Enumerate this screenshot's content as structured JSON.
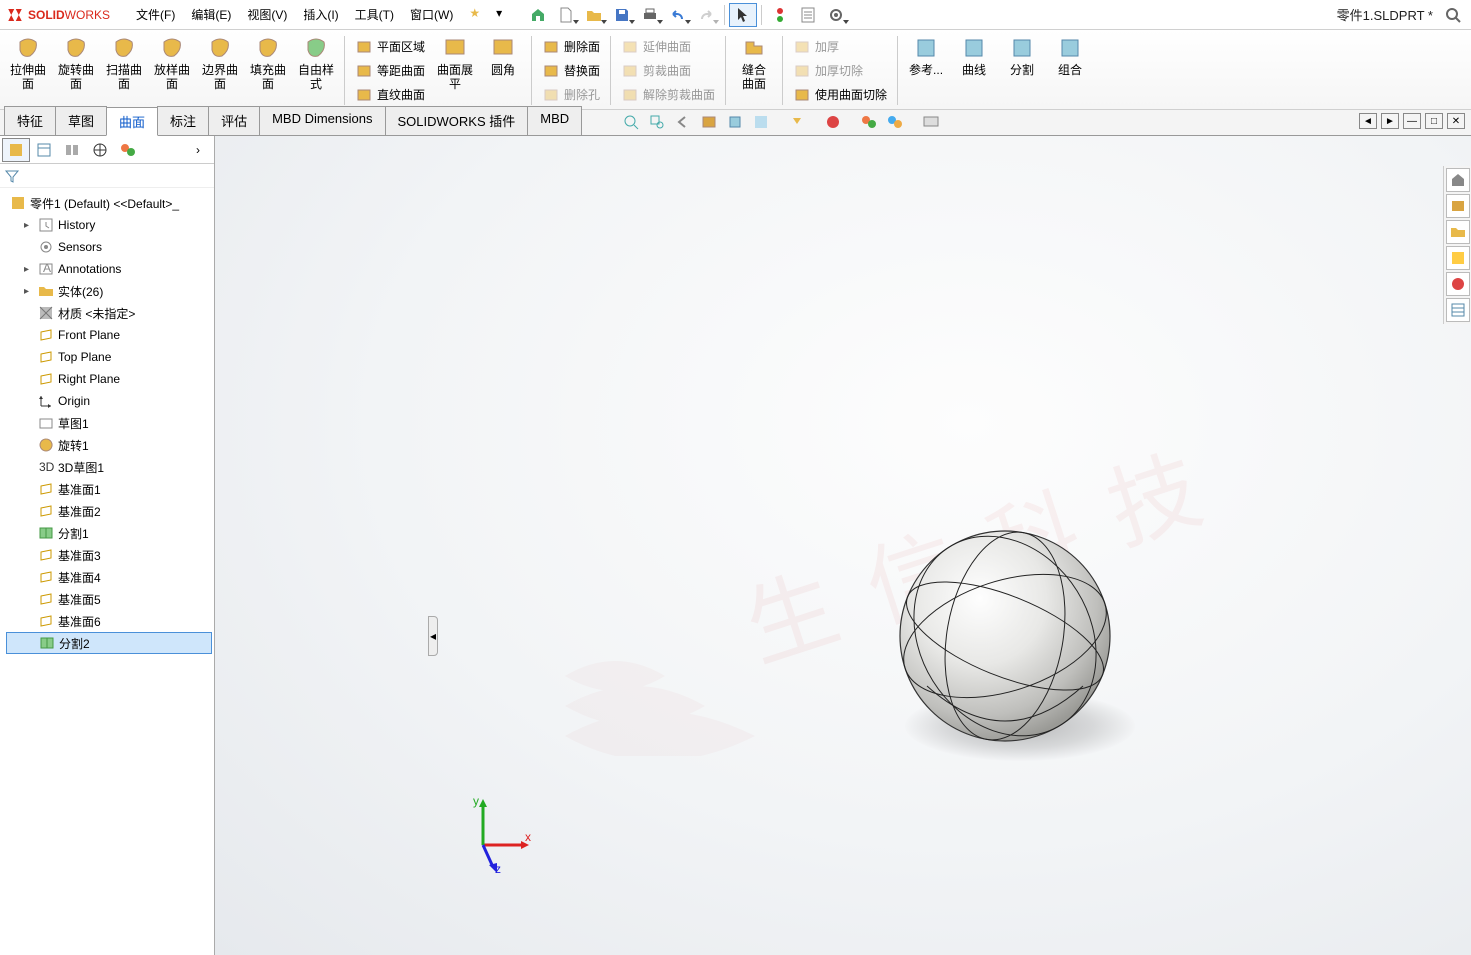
{
  "app": {
    "name_prefix": "SOLID",
    "name_suffix": "WORKS"
  },
  "document_title": "零件1.SLDPRT *",
  "menu": [
    "文件(F)",
    "编辑(E)",
    "视图(V)",
    "插入(I)",
    "工具(T)",
    "窗口(W)"
  ],
  "ribbon_large": [
    "拉伸曲\n面",
    "旋转曲\n面",
    "扫描曲\n面",
    "放样曲\n面",
    "边界曲\n面",
    "填充曲\n面",
    "自由样\n式"
  ],
  "ribbon_mid_a": [
    "平面区域",
    "等距曲面",
    "直纹曲面"
  ],
  "ribbon_mid_b": [
    "曲面展\n平",
    "圆角"
  ],
  "ribbon_mid_c": [
    "删除面",
    "替换面",
    "删除孔"
  ],
  "ribbon_mid_d": [
    "延伸曲面",
    "剪裁曲面",
    "解除剪裁曲面"
  ],
  "ribbon_mid_e": [
    "缝合\n曲面"
  ],
  "ribbon_mid_f": [
    "加厚",
    "加厚切除",
    "使用曲面切除"
  ],
  "ribbon_mid_g": [
    "参考...",
    "曲线",
    "分割",
    "组合"
  ],
  "tabs": [
    "特征",
    "草图",
    "曲面",
    "标注",
    "评估",
    "MBD Dimensions",
    "SOLIDWORKS 插件",
    "MBD"
  ],
  "active_tab": "曲面",
  "tree_root": "零件1 (Default) <<Default>_",
  "tree": [
    {
      "label": "History",
      "icon": "history",
      "exp": "▸"
    },
    {
      "label": "Sensors",
      "icon": "sensor",
      "exp": ""
    },
    {
      "label": "Annotations",
      "icon": "annot",
      "exp": "▸"
    },
    {
      "label": "实体(26)",
      "icon": "folder",
      "exp": "▸"
    },
    {
      "label": "材质 <未指定>",
      "icon": "material",
      "exp": "",
      "indent": 1
    },
    {
      "label": "Front Plane",
      "icon": "plane",
      "exp": "",
      "indent": 1
    },
    {
      "label": "Top Plane",
      "icon": "plane",
      "exp": "",
      "indent": 1
    },
    {
      "label": "Right Plane",
      "icon": "plane",
      "exp": "",
      "indent": 1
    },
    {
      "label": "Origin",
      "icon": "origin",
      "exp": "",
      "indent": 1
    },
    {
      "label": "草图1",
      "icon": "sketch",
      "exp": "",
      "indent": 1
    },
    {
      "label": "旋转1",
      "icon": "revolve",
      "exp": "",
      "indent": 1
    },
    {
      "label": "3D草图1",
      "icon": "sketch3d",
      "exp": "",
      "indent": 1
    },
    {
      "label": "基准面1",
      "icon": "plane",
      "exp": "",
      "indent": 1
    },
    {
      "label": "基准面2",
      "icon": "plane",
      "exp": "",
      "indent": 1
    },
    {
      "label": "分割1",
      "icon": "split",
      "exp": "",
      "indent": 1
    },
    {
      "label": "基准面3",
      "icon": "plane",
      "exp": "",
      "indent": 1
    },
    {
      "label": "基准面4",
      "icon": "plane",
      "exp": "",
      "indent": 1
    },
    {
      "label": "基准面5",
      "icon": "plane",
      "exp": "",
      "indent": 1
    },
    {
      "label": "基准面6",
      "icon": "plane",
      "exp": "",
      "indent": 1
    },
    {
      "label": "分割2",
      "icon": "split",
      "exp": "",
      "indent": 1,
      "sel": true
    }
  ],
  "triad": {
    "x": "x",
    "y": "y",
    "z": "z"
  }
}
